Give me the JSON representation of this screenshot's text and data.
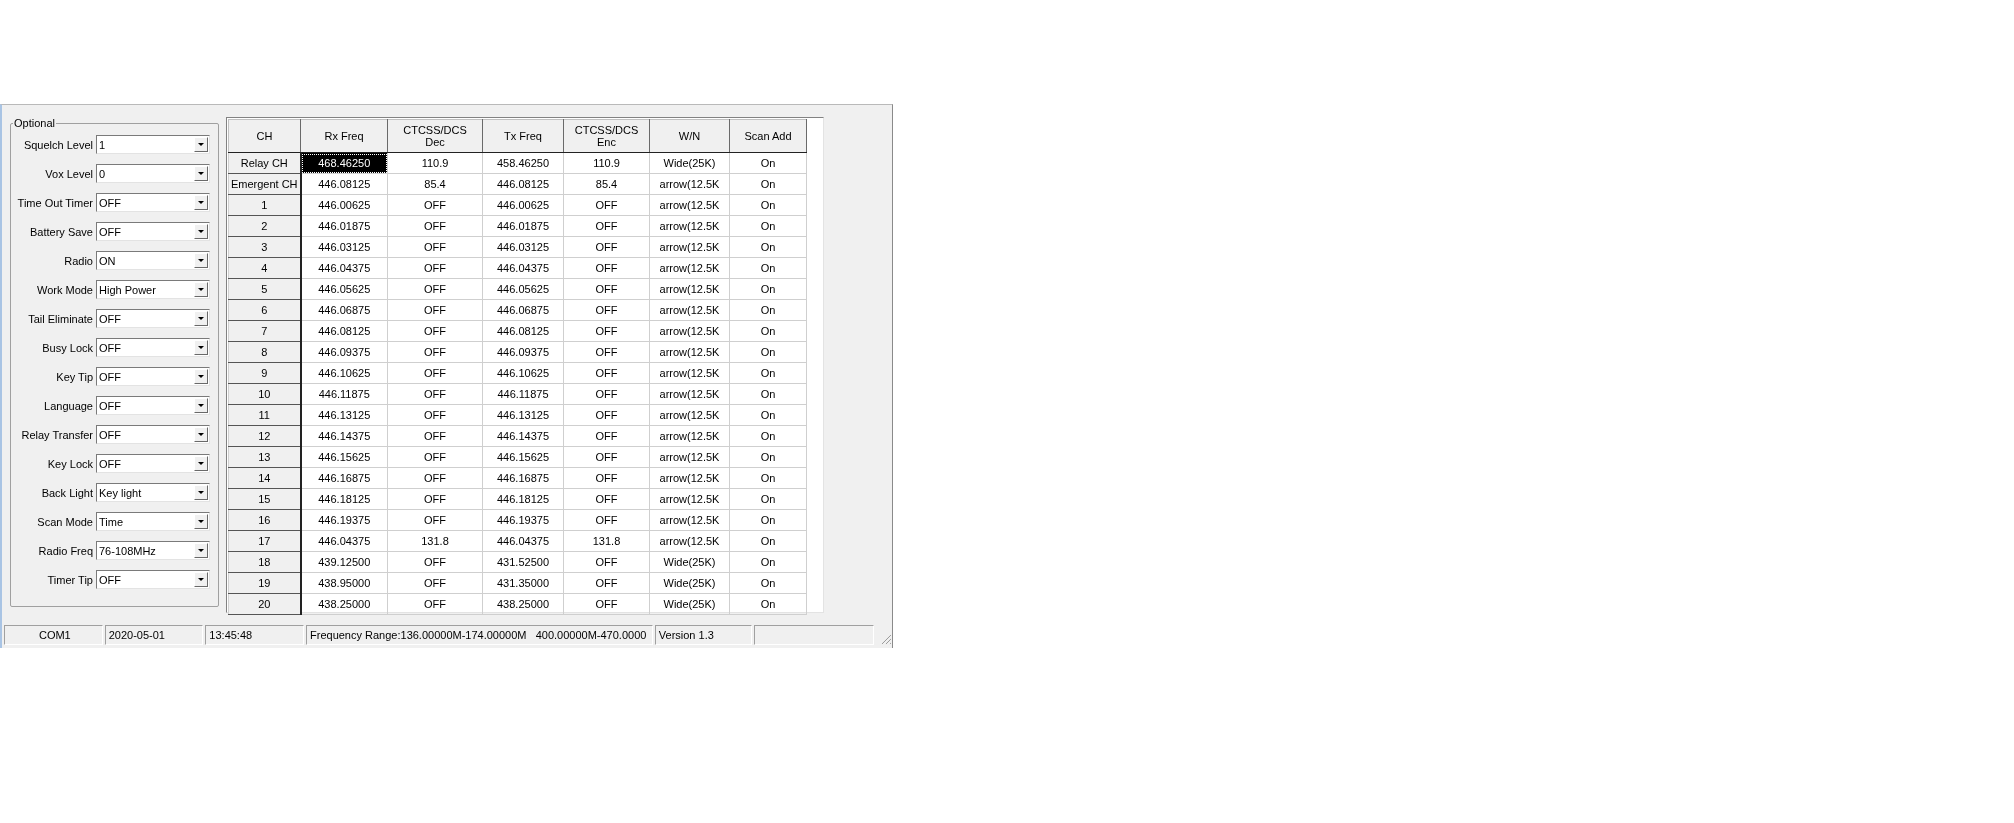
{
  "optional": {
    "title": "Optional",
    "settings": [
      {
        "label": "Squelch Level",
        "value": "1"
      },
      {
        "label": "Vox Level",
        "value": "0"
      },
      {
        "label": "Time Out Timer",
        "value": "OFF"
      },
      {
        "label": "Battery Save",
        "value": "OFF"
      },
      {
        "label": "Radio",
        "value": "ON"
      },
      {
        "label": "Work Mode",
        "value": "High Power"
      },
      {
        "label": "Tail Eliminate",
        "value": "OFF"
      },
      {
        "label": "Busy Lock",
        "value": "OFF"
      },
      {
        "label": "Key Tip",
        "value": "OFF"
      },
      {
        "label": "Language",
        "value": "OFF"
      },
      {
        "label": "Relay Transfer",
        "value": "OFF"
      },
      {
        "label": "Key Lock",
        "value": "OFF"
      },
      {
        "label": "Back Light",
        "value": "Key light"
      },
      {
        "label": "Scan Mode",
        "value": "Time"
      },
      {
        "label": "Radio Freq",
        "value": "76-108MHz"
      },
      {
        "label": "Timer Tip",
        "value": "OFF"
      }
    ]
  },
  "table": {
    "columns": [
      [
        "CH"
      ],
      [
        "Rx Freq"
      ],
      [
        "CTCSS/DCS",
        "Dec"
      ],
      [
        "Tx Freq"
      ],
      [
        "CTCSS/DCS",
        "Enc"
      ],
      [
        "W/N"
      ],
      [
        "Scan Add"
      ]
    ],
    "rows": [
      {
        "ch": "Relay CH",
        "rx": "468.46250",
        "dec": "110.9",
        "tx": "458.46250",
        "enc": "110.9",
        "wn": "Wide(25K)",
        "scan": "On",
        "rx_selected": true
      },
      {
        "ch": "Emergent CH",
        "rx": "446.08125",
        "dec": "85.4",
        "tx": "446.08125",
        "enc": "85.4",
        "wn": "arrow(12.5K",
        "scan": "On",
        "rx_selected": false
      },
      {
        "ch": "1",
        "rx": "446.00625",
        "dec": "OFF",
        "tx": "446.00625",
        "enc": "OFF",
        "wn": "arrow(12.5K",
        "scan": "On",
        "rx_selected": false
      },
      {
        "ch": "2",
        "rx": "446.01875",
        "dec": "OFF",
        "tx": "446.01875",
        "enc": "OFF",
        "wn": "arrow(12.5K",
        "scan": "On",
        "rx_selected": false
      },
      {
        "ch": "3",
        "rx": "446.03125",
        "dec": "OFF",
        "tx": "446.03125",
        "enc": "OFF",
        "wn": "arrow(12.5K",
        "scan": "On",
        "rx_selected": false
      },
      {
        "ch": "4",
        "rx": "446.04375",
        "dec": "OFF",
        "tx": "446.04375",
        "enc": "OFF",
        "wn": "arrow(12.5K",
        "scan": "On",
        "rx_selected": false
      },
      {
        "ch": "5",
        "rx": "446.05625",
        "dec": "OFF",
        "tx": "446.05625",
        "enc": "OFF",
        "wn": "arrow(12.5K",
        "scan": "On",
        "rx_selected": false
      },
      {
        "ch": "6",
        "rx": "446.06875",
        "dec": "OFF",
        "tx": "446.06875",
        "enc": "OFF",
        "wn": "arrow(12.5K",
        "scan": "On",
        "rx_selected": false
      },
      {
        "ch": "7",
        "rx": "446.08125",
        "dec": "OFF",
        "tx": "446.08125",
        "enc": "OFF",
        "wn": "arrow(12.5K",
        "scan": "On",
        "rx_selected": false
      },
      {
        "ch": "8",
        "rx": "446.09375",
        "dec": "OFF",
        "tx": "446.09375",
        "enc": "OFF",
        "wn": "arrow(12.5K",
        "scan": "On",
        "rx_selected": false
      },
      {
        "ch": "9",
        "rx": "446.10625",
        "dec": "OFF",
        "tx": "446.10625",
        "enc": "OFF",
        "wn": "arrow(12.5K",
        "scan": "On",
        "rx_selected": false
      },
      {
        "ch": "10",
        "rx": "446.11875",
        "dec": "OFF",
        "tx": "446.11875",
        "enc": "OFF",
        "wn": "arrow(12.5K",
        "scan": "On",
        "rx_selected": false
      },
      {
        "ch": "11",
        "rx": "446.13125",
        "dec": "OFF",
        "tx": "446.13125",
        "enc": "OFF",
        "wn": "arrow(12.5K",
        "scan": "On",
        "rx_selected": false
      },
      {
        "ch": "12",
        "rx": "446.14375",
        "dec": "OFF",
        "tx": "446.14375",
        "enc": "OFF",
        "wn": "arrow(12.5K",
        "scan": "On",
        "rx_selected": false
      },
      {
        "ch": "13",
        "rx": "446.15625",
        "dec": "OFF",
        "tx": "446.15625",
        "enc": "OFF",
        "wn": "arrow(12.5K",
        "scan": "On",
        "rx_selected": false
      },
      {
        "ch": "14",
        "rx": "446.16875",
        "dec": "OFF",
        "tx": "446.16875",
        "enc": "OFF",
        "wn": "arrow(12.5K",
        "scan": "On",
        "rx_selected": false
      },
      {
        "ch": "15",
        "rx": "446.18125",
        "dec": "OFF",
        "tx": "446.18125",
        "enc": "OFF",
        "wn": "arrow(12.5K",
        "scan": "On",
        "rx_selected": false
      },
      {
        "ch": "16",
        "rx": "446.19375",
        "dec": "OFF",
        "tx": "446.19375",
        "enc": "OFF",
        "wn": "arrow(12.5K",
        "scan": "On",
        "rx_selected": false
      },
      {
        "ch": "17",
        "rx": "446.04375",
        "dec": "131.8",
        "tx": "446.04375",
        "enc": "131.8",
        "wn": "arrow(12.5K",
        "scan": "On",
        "rx_selected": false
      },
      {
        "ch": "18",
        "rx": "439.12500",
        "dec": "OFF",
        "tx": "431.52500",
        "enc": "OFF",
        "wn": "Wide(25K)",
        "scan": "On",
        "rx_selected": false
      },
      {
        "ch": "19",
        "rx": "438.95000",
        "dec": "OFF",
        "tx": "431.35000",
        "enc": "OFF",
        "wn": "Wide(25K)",
        "scan": "On",
        "rx_selected": false
      },
      {
        "ch": "20",
        "rx": "438.25000",
        "dec": "OFF",
        "tx": "438.25000",
        "enc": "OFF",
        "wn": "Wide(25K)",
        "scan": "On",
        "rx_selected": false
      }
    ]
  },
  "status_bar": [
    "COM1",
    "2020-05-01",
    "13:45:48",
    "Frequency Range:136.00000M-174.00000M   400.00000M-470.0000",
    "Version 1.3"
  ]
}
